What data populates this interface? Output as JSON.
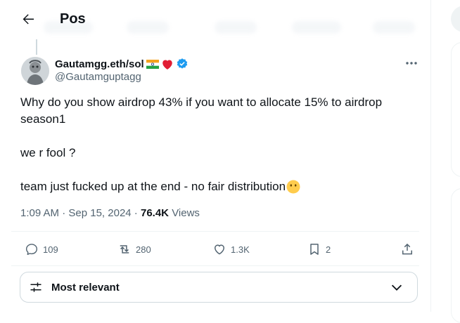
{
  "header": {
    "title": "Pos"
  },
  "tweet": {
    "display_name": "Gautamgg.eth/sol",
    "handle": "@Gautamguptagg",
    "text_line1": "Why do you show airdrop 43% if you want to allocate 15% to airdrop",
    "text_line2": "season1",
    "text_line3": "we r fool ?",
    "text_line4": "team just fucked up at the end - no fair distribution",
    "time": "1:09 AM",
    "date": "Sep 15, 2024",
    "views_count": "76.4K",
    "views_label": "Views"
  },
  "actions": {
    "replies": "109",
    "reposts": "280",
    "likes": "1.3K",
    "bookmarks": "2"
  },
  "sort": {
    "label": "Most relevant"
  },
  "colors": {
    "verified": "#1d9bf0",
    "text": "#0f1419",
    "muted": "#536471",
    "border": "#cfd9de"
  },
  "icons": [
    "back-arrow-icon",
    "india-flag-icon",
    "red-heart-icon",
    "verified-badge-icon",
    "more-icon",
    "reply-icon",
    "repost-icon",
    "like-icon",
    "bookmark-icon",
    "share-icon",
    "sliders-icon",
    "chevron-down-icon",
    "grimace-emoji-icon"
  ]
}
